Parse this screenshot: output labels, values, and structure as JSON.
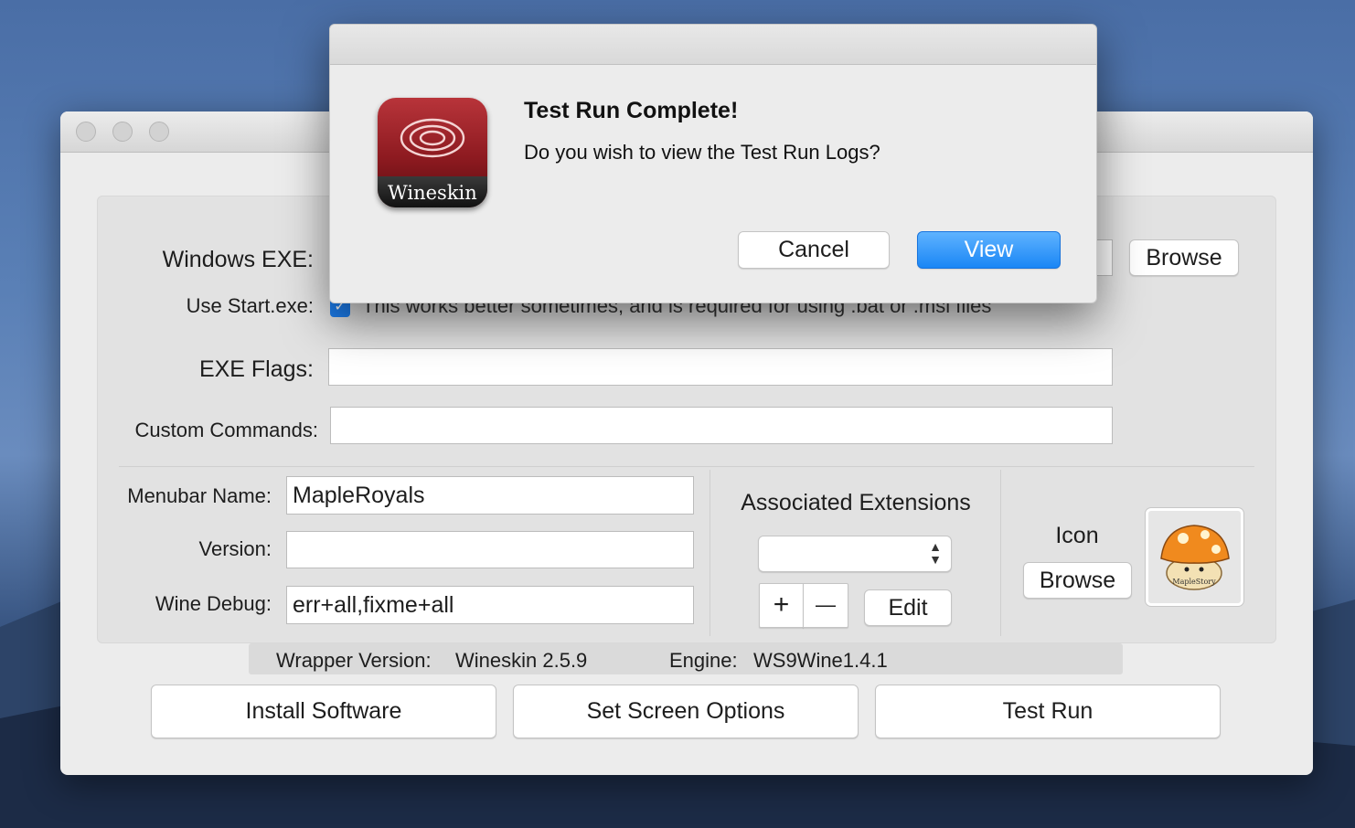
{
  "main_window": {
    "windows_exe_label": "Windows EXE:",
    "browse_exe_label": "Browse",
    "use_start_label": "Use Start.exe:",
    "use_start_checked": true,
    "use_start_desc": "This works better sometimes, and is required for using .bat or .msi files",
    "exe_flags_label": "EXE Flags:",
    "exe_flags_value": "",
    "custom_commands_label": "Custom Commands:",
    "custom_commands_value": "",
    "menubar_name_label": "Menubar Name:",
    "menubar_name_value": "MapleRoyals",
    "version_label": "Version:",
    "version_value": "",
    "wine_debug_label": "Wine Debug:",
    "wine_debug_value": "err+all,fixme+all",
    "associated_extensions_label": "Associated Extensions",
    "ext_add": "+",
    "ext_remove": "—",
    "ext_edit": "Edit",
    "icon_label": "Icon",
    "icon_browse": "Browse",
    "icon_image_name": "MapleStory",
    "wrapper_version_label": "Wrapper Version:",
    "wrapper_version_value": "Wineskin 2.5.9",
    "engine_label": "Engine:",
    "engine_value": "WS9Wine1.4.1",
    "install_software": "Install Software",
    "set_screen_options": "Set Screen Options",
    "test_run": "Test Run"
  },
  "dialog": {
    "icon_text": "Wineskin",
    "title": "Test Run Complete!",
    "message": "Do you wish to view the Test Run Logs?",
    "cancel": "Cancel",
    "view": "View"
  },
  "colors": {
    "accent": "#1a86f5",
    "window_bg": "#ececec",
    "icon_red": "#8d1a20"
  }
}
